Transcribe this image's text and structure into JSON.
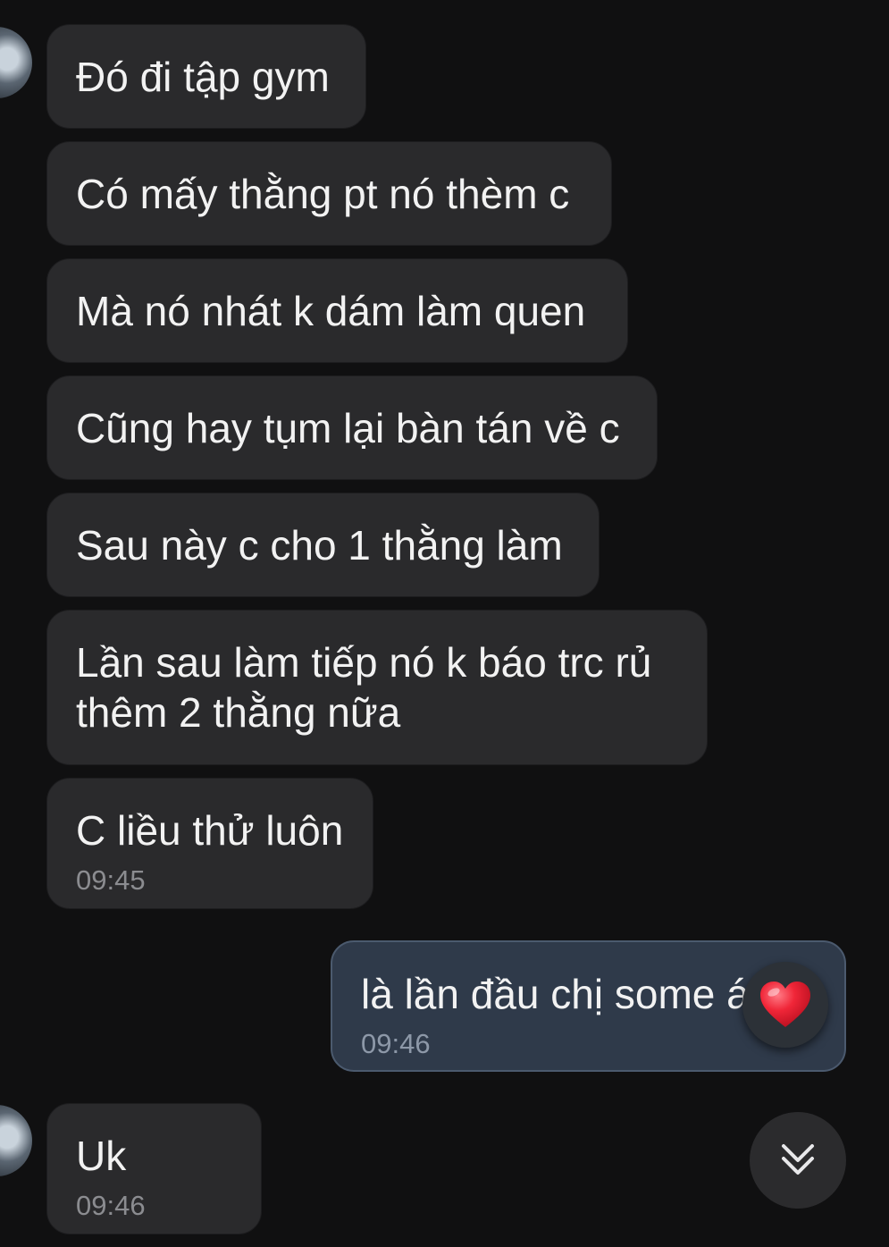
{
  "messages": [
    {
      "text": "Đó đi tập gym"
    },
    {
      "text": "Có mấy thằng pt nó thèm c"
    },
    {
      "text": "Mà nó nhát k dám làm quen"
    },
    {
      "text": "Cũng hay tụm lại bàn tán về c"
    },
    {
      "text": "Sau này c cho 1 thằng làm"
    },
    {
      "text": "Lần sau làm tiếp nó k báo trc rủ",
      "text2": "thêm 2 thằng nữa"
    },
    {
      "text": "C liều thử luôn",
      "time": "09:45"
    },
    {
      "text": "là lần đầu chị some á hơ",
      "time": "09:46",
      "outgoing": true,
      "reaction": "heart-icon"
    },
    {
      "text": "Uk",
      "time": "09:46"
    }
  ],
  "colors": {
    "background": "#101011",
    "incoming_bubble": "#2a2a2c",
    "outgoing_bubble": "#2f3a4a",
    "reaction_heart": "#e8192c"
  },
  "icons": {
    "reaction": "heart-icon",
    "scroll_down": "double-chevron-down-icon"
  }
}
